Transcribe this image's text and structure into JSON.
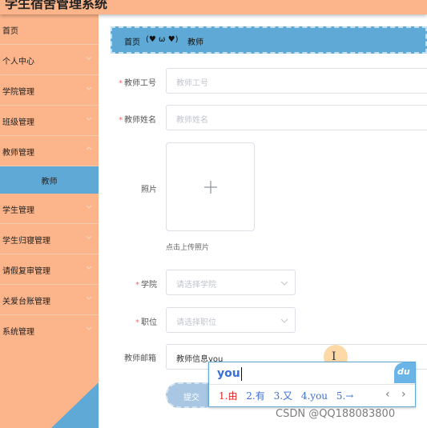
{
  "app": {
    "title": "学生宿舍管理系统"
  },
  "sidebar": {
    "items": [
      {
        "label": "首页"
      },
      {
        "label": "个人中心"
      },
      {
        "label": "学院管理"
      },
      {
        "label": "班级管理"
      },
      {
        "label": "教师管理"
      },
      {
        "label": "学生管理"
      },
      {
        "label": "学生归寝管理"
      },
      {
        "label": "请假复审管理"
      },
      {
        "label": "关爱台账管理"
      },
      {
        "label": "系统管理"
      }
    ],
    "active_sub": {
      "label": "教师"
    },
    "colors": {
      "background": "#fcb58b",
      "active": "#5fa9d6"
    }
  },
  "breadcrumb": {
    "home": "首页",
    "separator": "(♥ ω ♥)",
    "current": "教师"
  },
  "form": {
    "teacher_id": {
      "label": "教师工号",
      "placeholder": "教师工号"
    },
    "teacher_name": {
      "label": "教师姓名",
      "placeholder": "教师姓名"
    },
    "photo": {
      "label": "照片",
      "upload_tip": "点击上传照片"
    },
    "college": {
      "label": "学院",
      "placeholder": "请选择学院"
    },
    "position": {
      "label": "职位",
      "placeholder": "请选择职位"
    },
    "email": {
      "label": "教师邮箱",
      "value_prefix": "教师信息",
      "value_composing": "you"
    },
    "submit_label": "提交"
  },
  "ime": {
    "composition": "you",
    "candidates": [
      "1.由",
      "2.有",
      "3.又",
      "4.you",
      "5.→"
    ],
    "prev_page": "‹",
    "next_page": "›",
    "badge": "du"
  },
  "watermark": "CSDN @QQ188083800"
}
